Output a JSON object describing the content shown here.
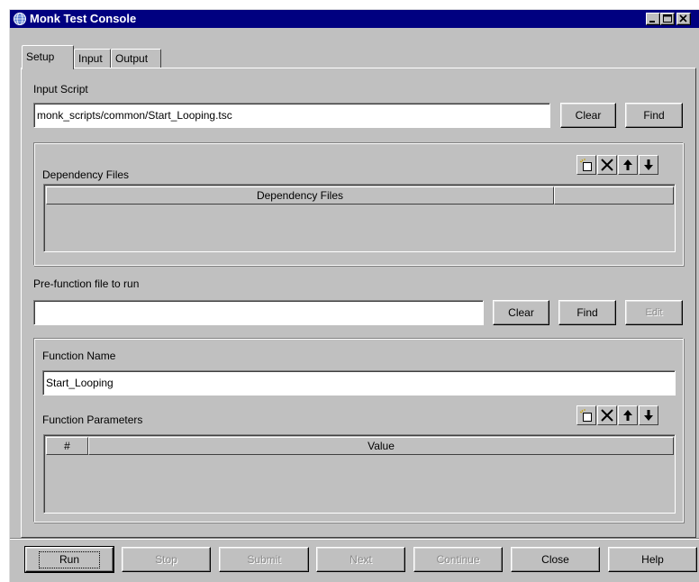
{
  "window": {
    "title": "Monk Test Console"
  },
  "tabs": [
    {
      "label": "Setup",
      "active": true
    },
    {
      "label": "Input",
      "active": false
    },
    {
      "label": "Output",
      "active": false
    }
  ],
  "input_script": {
    "label": "Input Script",
    "value": "monk_scripts/common/Start_Looping.tsc",
    "clear_label": "Clear",
    "find_label": "Find"
  },
  "dependency": {
    "label": "Dependency Files",
    "columns": [
      "Dependency Files",
      ""
    ],
    "rows": []
  },
  "prefunction": {
    "label": "Pre-function file to run",
    "value": "",
    "clear_label": "Clear",
    "find_label": "Find",
    "edit_label": "Edit"
  },
  "function": {
    "name_label": "Function Name",
    "name_value": "Start_Looping",
    "params_label": "Function Parameters",
    "columns": [
      "#",
      "Value"
    ],
    "rows": []
  },
  "footer": {
    "run_label": "Run",
    "stop_label": "Stop",
    "submit_label": "Submit",
    "next_label": "Next",
    "continue_label": "Continue",
    "close_label": "Close",
    "help_label": "Help"
  },
  "icons": {
    "app": "globe-icon",
    "new": "new-item-icon",
    "delete": "delete-x-icon",
    "up": "arrow-up-icon",
    "down": "arrow-down-icon"
  },
  "colors": {
    "titlebar": "#000080",
    "face": "#c0c0c0"
  }
}
